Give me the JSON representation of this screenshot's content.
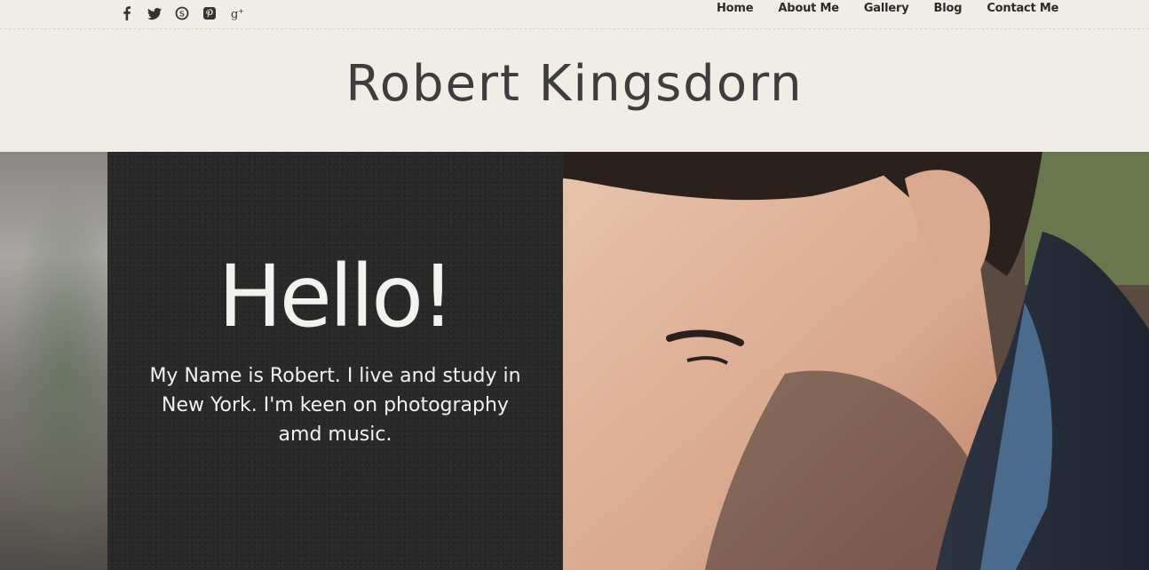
{
  "social": [
    {
      "name": "facebook-icon",
      "glyph": "f"
    },
    {
      "name": "twitter-icon",
      "glyph": "t"
    },
    {
      "name": "skype-icon",
      "glyph": "s"
    },
    {
      "name": "pinterest-icon",
      "glyph": "p"
    },
    {
      "name": "google-plus-icon",
      "glyph": "g+"
    }
  ],
  "nav": {
    "home": "Home",
    "about": "About Me",
    "gallery": "Gallery",
    "blog": "Blog",
    "contact": "Contact Me"
  },
  "site": {
    "title": "Robert Kingsdorn"
  },
  "hero": {
    "greeting": "Hello!",
    "intro": "My Name is Robert. I live and study in New York. I'm keen on photography amd music."
  },
  "colors": {
    "background": "#f0ede7",
    "chalkboard": "#2a2929",
    "text_dark": "#2b2b2b",
    "chalk_text": "#f4f2ee"
  }
}
